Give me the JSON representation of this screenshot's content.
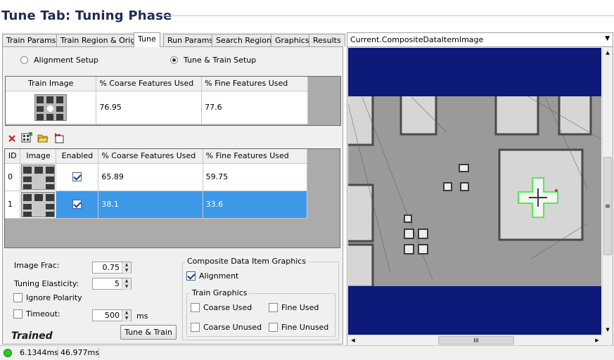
{
  "page": {
    "title": "Tune Tab: Tuning Phase"
  },
  "tabs": [
    "Train Params",
    "Train Region & Origin",
    "Tune",
    "Run Params",
    "Search Region",
    "Graphics",
    "Results"
  ],
  "active_tab": "Tune",
  "mode": {
    "alignment_setup": "Alignment Setup",
    "tune_train_setup": "Tune & Train Setup",
    "selected": "Tune & Train Setup"
  },
  "train_table": {
    "headers": [
      "Train Image",
      "% Coarse Features Used",
      "% Fine Features Used"
    ],
    "row": {
      "coarse": "76.95",
      "fine": "77.6"
    }
  },
  "toolbar": {
    "delete_icon": "delete-icon",
    "add_icon": "add-image-icon",
    "open_icon": "open-folder-icon",
    "import_icon": "import-icon"
  },
  "tune_table": {
    "headers": [
      "ID",
      "Image",
      "Enabled",
      "% Coarse Features Used",
      "% Fine Features Used"
    ],
    "rows": [
      {
        "id": "0",
        "enabled": true,
        "coarse": "65.89",
        "fine": "59.75",
        "selected": false
      },
      {
        "id": "1",
        "enabled": true,
        "coarse": "38.1",
        "fine": "33.6",
        "selected": true
      }
    ]
  },
  "params": {
    "image_frac_label": "Image Frac:",
    "image_frac_value": "0.75",
    "tuning_elasticity_label": "Tuning Elasticity:",
    "tuning_elasticity_value": "5",
    "ignore_polarity_label": "Ignore Polarity",
    "timeout_label": "Timeout:",
    "timeout_value": "500",
    "timeout_unit": "ms",
    "trained_label": "Trained",
    "tune_train_button": "Tune & Train"
  },
  "graphics": {
    "group_title": "Composite Data Item Graphics",
    "alignment_label": "Alignment",
    "alignment_checked": true,
    "train_group_title": "Train Graphics",
    "coarse_used": "Coarse Used",
    "fine_used": "Fine Used",
    "coarse_unused": "Coarse Unused",
    "fine_unused": "Fine Unused"
  },
  "status": {
    "indicator_color": "#22cc22",
    "time1": "6.1344ms",
    "time2": "46.977ms"
  },
  "viewer": {
    "combo_value": "Current.CompositeDataItemImage",
    "background_color": "#0d1a7a",
    "hscroll_grip": "III",
    "vscroll_grip": "≡"
  }
}
